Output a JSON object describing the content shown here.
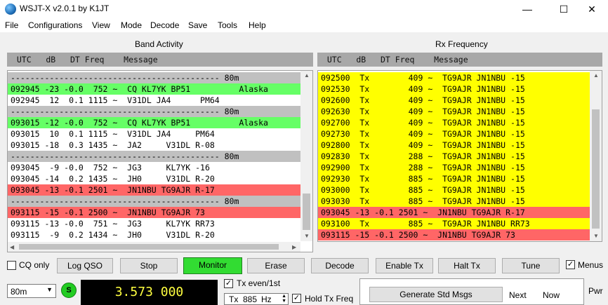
{
  "window": {
    "title": "WSJT-X  v2.0.1  by K1JT",
    "minimize": "—",
    "maximize": "☐",
    "close": "✕"
  },
  "menu": [
    "File",
    "Configurations",
    "View",
    "Mode",
    "Decode",
    "Save",
    "Tools",
    "Help"
  ],
  "band_activity": {
    "label": "Band Activity",
    "header": "  UTC   dB   DT Freq    Message",
    "rows": [
      {
        "text": "------------------------------------------- 80m",
        "kind": "sep"
      },
      {
        "text": "092945 -23 -0.0  752 ~  CQ KL7YK BP51          Alaska",
        "kind": "cq"
      },
      {
        "text": "092945  12  0.1 1115 ~  V31DL JA4      PM64",
        "kind": "normal"
      },
      {
        "text": "------------------------------------------- 80m",
        "kind": "sep"
      },
      {
        "text": "093015 -12 -0.0  752 ~  CQ KL7YK BP51          Alaska",
        "kind": "cq"
      },
      {
        "text": "093015  10  0.1 1115 ~  V31DL JA4     PM64",
        "kind": "normal"
      },
      {
        "text": "093015 -18  0.3 1435 ~  JA2     V31DL R-08",
        "kind": "normal"
      },
      {
        "text": "------------------------------------------- 80m",
        "kind": "sep"
      },
      {
        "text": "093045  -9 -0.0  752 ~  JG3     KL7YK -16",
        "kind": "normal"
      },
      {
        "text": "093045 -14  0.2 1435 ~  JH0     V31DL R-20",
        "kind": "normal"
      },
      {
        "text": "093045 -13 -0.1 2501 ~  JN1NBU TG9AJR R-17",
        "kind": "mine"
      },
      {
        "text": "------------------------------------------- 80m",
        "kind": "sep"
      },
      {
        "text": "093115 -15 -0.1 2500 ~  JN1NBU TG9AJR 73",
        "kind": "mine"
      },
      {
        "text": "093115 -13 -0.0  751 ~  JG3     KL7YK RR73",
        "kind": "normal"
      },
      {
        "text": "093115  -9  0.2 1434 ~  JH0     V31DL R-20",
        "kind": "normal"
      }
    ]
  },
  "rx_frequency": {
    "label": "Rx Frequency",
    "header": "  UTC   dB   DT Freq    Message",
    "rows": [
      {
        "text": "092500  Tx        409 ~  TG9AJR JN1NBU -15",
        "kind": "tx"
      },
      {
        "text": "092530  Tx        409 ~  TG9AJR JN1NBU -15",
        "kind": "tx"
      },
      {
        "text": "092600  Tx        409 ~  TG9AJR JN1NBU -15",
        "kind": "tx"
      },
      {
        "text": "092630  Tx        409 ~  TG9AJR JN1NBU -15",
        "kind": "tx"
      },
      {
        "text": "092700  Tx        409 ~  TG9AJR JN1NBU -15",
        "kind": "tx"
      },
      {
        "text": "092730  Tx        409 ~  TG9AJR JN1NBU -15",
        "kind": "tx"
      },
      {
        "text": "092800  Tx        409 ~  TG9AJR JN1NBU -15",
        "kind": "tx"
      },
      {
        "text": "092830  Tx        288 ~  TG9AJR JN1NBU -15",
        "kind": "tx"
      },
      {
        "text": "092900  Tx        288 ~  TG9AJR JN1NBU -15",
        "kind": "tx"
      },
      {
        "text": "092930  Tx        885 ~  TG9AJR JN1NBU -15",
        "kind": "tx"
      },
      {
        "text": "093000  Tx        885 ~  TG9AJR JN1NBU -15",
        "kind": "tx"
      },
      {
        "text": "093030  Tx        885 ~  TG9AJR JN1NBU -15",
        "kind": "tx"
      },
      {
        "text": "093045 -13 -0.1 2501 ~  JN1NBU TG9AJR R-17",
        "kind": "mine"
      },
      {
        "text": "093100  Tx        885 ~  TG9AJR JN1NBU RR73",
        "kind": "tx"
      },
      {
        "text": "093115 -15 -0.1 2500 ~  JN1NBU TG9AJR 73",
        "kind": "mine"
      }
    ]
  },
  "controls": {
    "cq_only": "CQ only",
    "log_qso": "Log QSO",
    "stop": "Stop",
    "monitor": "Monitor",
    "erase": "Erase",
    "decode": "Decode",
    "enable_tx": "Enable Tx",
    "halt_tx": "Halt Tx",
    "tune": "Tune",
    "menus": "Menus"
  },
  "bottom": {
    "band": "80m",
    "s_indicator": "S",
    "frequency": "3.573 000",
    "tx_even": "Tx even/1st",
    "tx_label": "Tx",
    "tx_freq": "885",
    "tx_unit": "Hz",
    "hold_tx": "Hold Tx Freq",
    "generate": "Generate Std Msgs",
    "next": "Next",
    "now": "Now",
    "pwr": "Pwr"
  },
  "colors": {
    "cq": "#66ff66",
    "mine": "#ff6666",
    "tx": "#ffff00",
    "sep": "#c0c0c0",
    "monitor": "#32dc32"
  }
}
